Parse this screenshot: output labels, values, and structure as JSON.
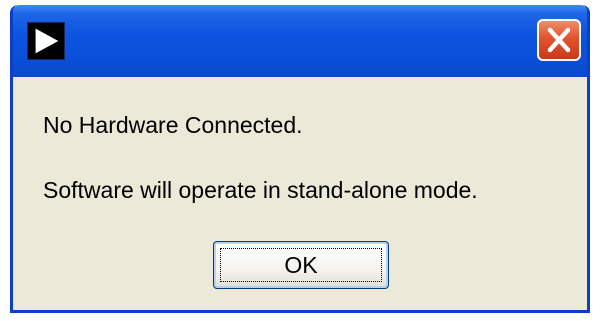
{
  "dialog": {
    "title": "",
    "icon": "play-arrow-icon",
    "close_icon": "close-icon",
    "message_line1": "No Hardware Connected.",
    "message_line2": "Software will operate in stand-alone mode.",
    "ok_label": "OK"
  },
  "colors": {
    "titlebar": "#0b53e0",
    "window_border": "#0a3fc9",
    "body_background": "#ece9d8",
    "close_button": "#e2532f"
  }
}
